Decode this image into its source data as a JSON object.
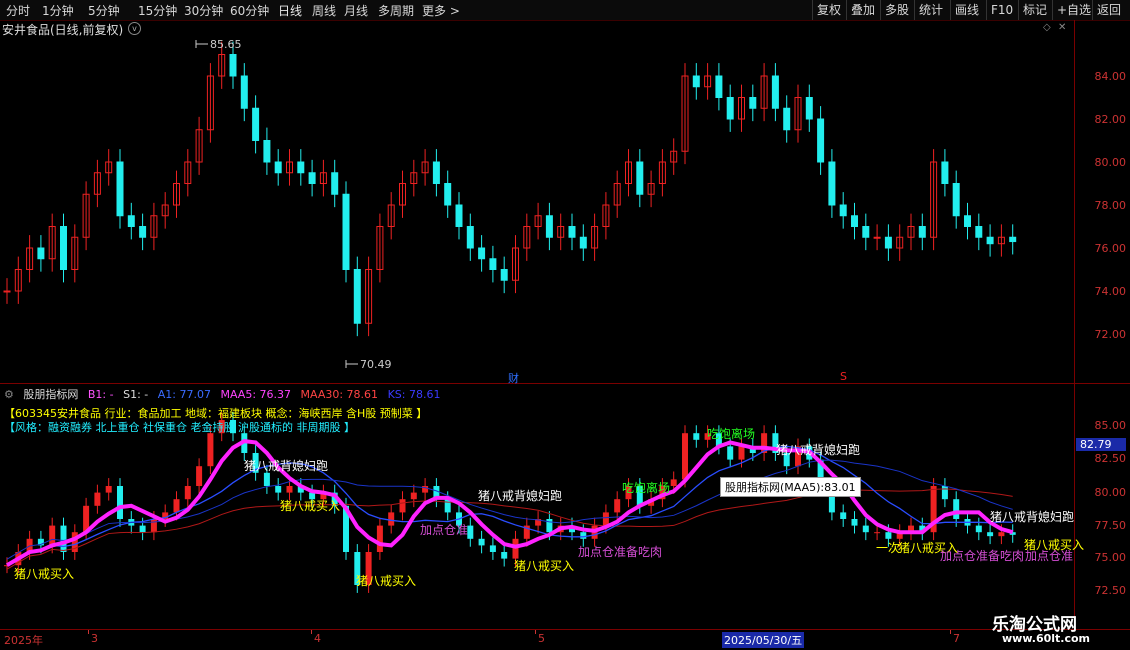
{
  "toolbar": {
    "left": [
      "分时",
      "1分钟",
      "5分钟",
      "15分钟",
      "30分钟",
      "60分钟",
      "日线",
      "周线",
      "月线",
      "多周期",
      "更多 >"
    ],
    "right": [
      "复权",
      "叠加",
      "多股",
      "统计",
      "画线",
      "F10",
      "标记",
      "+自选",
      "返回"
    ]
  },
  "chart_title": "安井食品(日线,前复权)",
  "price_axis": [
    "84.00",
    "82.00",
    "80.00",
    "78.00",
    "76.00",
    "74.00",
    "72.00"
  ],
  "price_markers": {
    "high": "85.65",
    "low": "70.49",
    "cai": "财",
    "s": "S"
  },
  "indicator": {
    "name": "股朋指标网",
    "b1": "B1: -",
    "s1": "S1: -",
    "a1": "A1: 77.07",
    "maa5": "MAA5: 76.37",
    "maa30": "MAA30: 78.61",
    "ks": "KS: 78.61",
    "info_line1": "【603345安井食品 行业：食品加工 地域：福建板块 概念：海峡西岸 含H股 预制菜 】",
    "info_line2": "【风格：融资融券 北上重仓 社保重仓 老金持股 沪股通标的 非周期股 】",
    "axis": [
      "85.00",
      "82.50",
      "80.00",
      "77.50",
      "75.00",
      "72.50"
    ],
    "current": "82.79",
    "tooltip": "股朋指标网(MAA5):83.01"
  },
  "signals": {
    "buy": "猪八戒买入",
    "run": "猪八戒背媳妇跑",
    "add": "加点仓准备吃肉",
    "full": "吃饱离场",
    "add_short": "加点仓准",
    "add_tail": "加点仓准",
    "one": "一次"
  },
  "dates": [
    "2025年",
    "3",
    "4",
    "5",
    "2025/05/30/五",
    "7"
  ],
  "watermark": {
    "main": "乐淘公式网",
    "url": "www.60lt.com"
  },
  "colors": {
    "up": "#e22",
    "down": "#2ee",
    "maa5": "#ff22ff",
    "blue": "#2a4dff",
    "red": "#c22",
    "yellow": "#ff0",
    "green": "#2f2",
    "purple": "#d44ed4"
  }
}
